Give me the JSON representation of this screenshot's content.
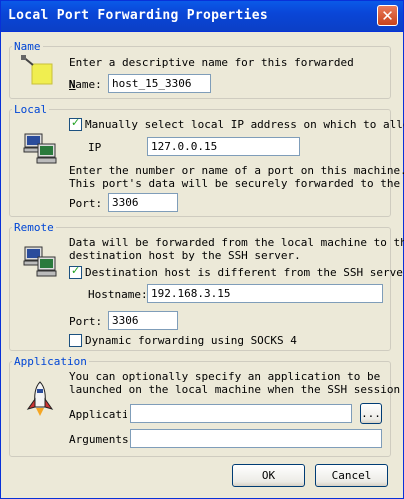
{
  "window": {
    "title": "Local Port Forwarding Properties"
  },
  "name_group": {
    "legend": "Name",
    "description": "Enter a descriptive name for this forwarded",
    "name_label": "Name:",
    "name_value": "host_15_3306"
  },
  "local_group": {
    "legend": "Local",
    "manual_ip_label": "Manually select local IP address on which to allow",
    "manual_ip_checked": true,
    "ip_label": "IP",
    "ip_value": "127.0.0.15",
    "port_desc_1": "Enter the number or name of a port on this machine.",
    "port_desc_2": "This port's data will be securely forwarded to the",
    "port_label": "Port:",
    "port_value": "3306"
  },
  "remote_group": {
    "legend": "Remote",
    "desc_1": "Data will be forwarded from the local machine to the",
    "desc_2": "destination host by the SSH server.",
    "dest_diff_label": "Destination host is different from the SSH server.",
    "dest_diff_checked": true,
    "hostname_label": "Hostname:",
    "hostname_value": "192.168.3.15",
    "port_label": "Port:",
    "port_value": "3306",
    "dynamic_label": "Dynamic forwarding using SOCKS 4",
    "dynamic_checked": false
  },
  "application_group": {
    "legend": "Application",
    "desc_1": "You can optionally specify an application to be",
    "desc_2": "launched on the local machine when the SSH session",
    "application_label": "Applicati",
    "application_value": "",
    "browse_label": "...",
    "arguments_label": "Arguments",
    "arguments_value": ""
  },
  "buttons": {
    "ok": "OK",
    "cancel": "Cancel"
  },
  "icons": {
    "name": "name-tag-icon",
    "local": "computers-icon",
    "remote": "computers-icon",
    "application": "rocket-icon",
    "close": "close-icon"
  }
}
